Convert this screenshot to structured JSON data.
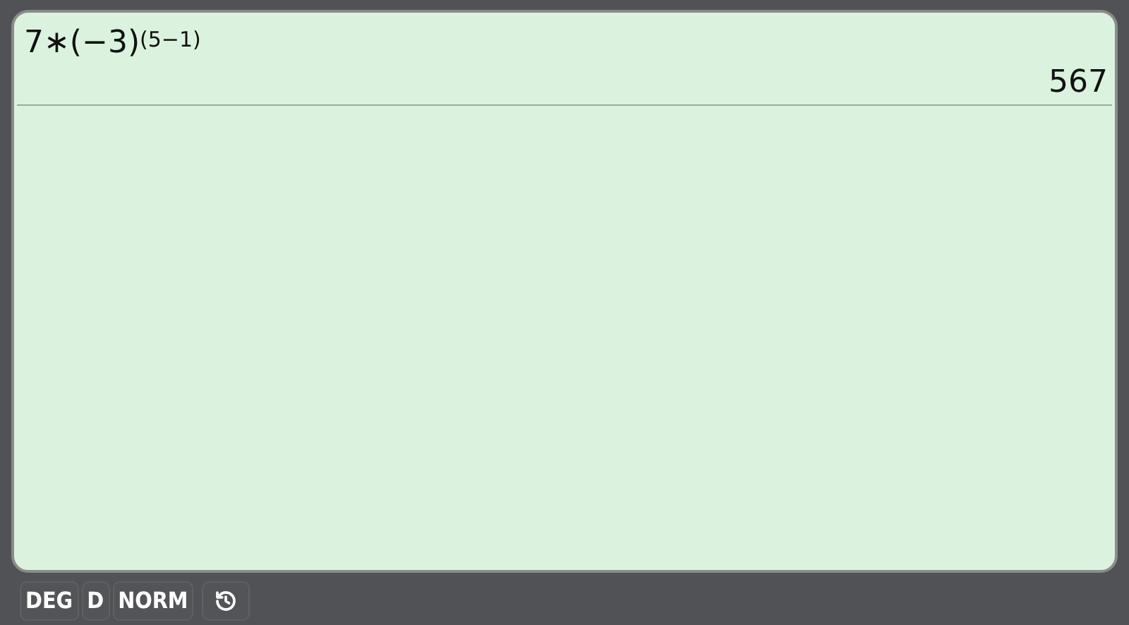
{
  "history": [
    {
      "expression": "7∗(−3)$^{(5−1)}$",
      "result": "567"
    }
  ],
  "status_bar": {
    "buttons": [
      "DEG",
      "D",
      "NORM"
    ]
  }
}
